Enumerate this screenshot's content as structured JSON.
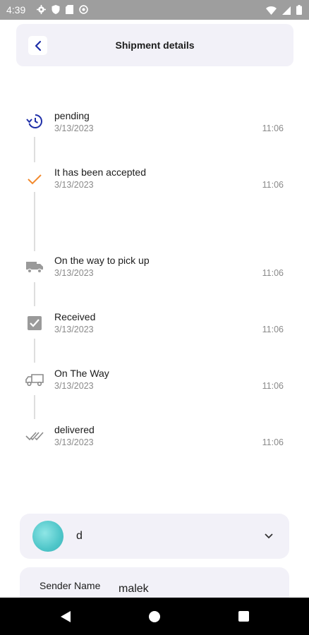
{
  "status_bar": {
    "time": "4:39"
  },
  "header": {
    "title": "Shipment details"
  },
  "timeline": [
    {
      "title": "pending",
      "date": "3/13/2023",
      "time": "11:06",
      "icon": "history-icon"
    },
    {
      "title": "It has been accepted",
      "date": "3/13/2023",
      "time": "11:06",
      "icon": "check-icon"
    },
    {
      "title": "On the way to pick up",
      "date": "3/13/2023",
      "time": "11:06",
      "icon": "truck-filled-icon"
    },
    {
      "title": "Received",
      "date": "3/13/2023",
      "time": "11:06",
      "icon": "checkbox-icon"
    },
    {
      "title": "On The Way",
      "date": "3/13/2023",
      "time": "11:06",
      "icon": "truck-outline-icon"
    },
    {
      "title": "delivered",
      "date": "3/13/2023",
      "time": "11:06",
      "icon": "double-check-icon"
    }
  ],
  "sender_card": {
    "name": "d",
    "icon": "chevron-down-icon"
  },
  "details": {
    "sender_name_label": "Sender Name",
    "sender_name_value": "malek"
  },
  "colors": {
    "accent": "#1f2fa8",
    "check": "#f28a2e",
    "card_bg": "#f2f1f8",
    "muted": "#8a8a8a"
  }
}
